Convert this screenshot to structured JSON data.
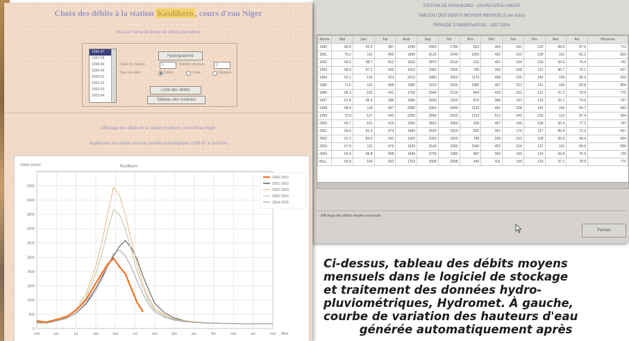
{
  "left_window": {
    "title_pre": "Choix des débits à la station",
    "title_station": "Koulikoro",
    "title_post": ", cours d'eau Niger",
    "subtitle": "Mise en forme du fichier de débits journaliers",
    "year_list": [
      "1996-97",
      "1997-98",
      "1998-99",
      "1999-00",
      "2000-01",
      "2001-02",
      "2002-03",
      "2003-04"
    ],
    "selected_year_index": 0,
    "button_hydrogramme": "Hydrogramme",
    "label_1": "Choix de l'année",
    "label_2": "Nombre de jours",
    "label_3": "Type de tracé",
    "radio_labels": [
      "Débits",
      "Cotes",
      "Volumes"
    ],
    "spin_1": "1",
    "spin_2": "1",
    "button_liste": "Liste des débits",
    "button_tableau": "Tableau des modules",
    "info_line_1": "Affichage des débits de la station Koulikoro, cours d'eau Niger",
    "info_line_2": "Superposer des débits annuels (années hydrologiques 1996-97 à 2003-04)"
  },
  "right_window": {
    "header_lines": [
      "STATION DE KOULIKORO - COURS D'EAU NIGER",
      "TABLEAU DES DEBITS MOYENS MENSUELS (en m3/s)",
      "PERIODE D'OBSERVATION : 1907-2004"
    ],
    "columns": [
      "Année",
      "Mai",
      "Juin",
      "Juil",
      "Août",
      "Sep",
      "Oct",
      "Nov",
      "Déc",
      "Jan",
      "Fév",
      "Mar",
      "Avr",
      "Moyenne"
    ],
    "rows": [
      [
        "1990",
        "86.8",
        "92.5",
        "387",
        "1540",
        "2560",
        "1780",
        "823",
        "364",
        "181",
        "120",
        "98.6",
        "87.6",
        "713"
      ],
      [
        "1991",
        "70.2",
        "110",
        "455",
        "1890",
        "3120",
        "2240",
        "1050",
        "452",
        "215",
        "138",
        "101",
        "81.2",
        "829"
      ],
      [
        "1992",
        "64.5",
        "98.7",
        "412",
        "1620",
        "2870",
        "2010",
        "912",
        "401",
        "194",
        "126",
        "94.3",
        "76.4",
        "741"
      ],
      [
        "1993",
        "58.9",
        "87.2",
        "356",
        "1410",
        "2350",
        "1690",
        "785",
        "342",
        "168",
        "112",
        "86.7",
        "70.1",
        "627"
      ],
      [
        "1994",
        "62.1",
        "124",
        "523",
        "2210",
        "3480",
        "2560",
        "1170",
        "498",
        "236",
        "149",
        "109",
        "85.3",
        "935"
      ],
      [
        "1995",
        "71.6",
        "115",
        "468",
        "1980",
        "3210",
        "2330",
        "1080",
        "467",
        "221",
        "141",
        "104",
        "82.8",
        "858"
      ],
      [
        "1996",
        "66.3",
        "103",
        "431",
        "1750",
        "2940",
        "2120",
        "964",
        "418",
        "201",
        "131",
        "97.2",
        "78.9",
        "775"
      ],
      [
        "1997",
        "61.8",
        "95.4",
        "398",
        "1580",
        "2690",
        "1920",
        "876",
        "386",
        "187",
        "123",
        "92.1",
        "74.6",
        "707"
      ],
      [
        "1998",
        "68.4",
        "118",
        "497",
        "2080",
        "3350",
        "2440",
        "1120",
        "481",
        "228",
        "145",
        "106",
        "83.7",
        "893"
      ],
      [
        "1999",
        "73.9",
        "127",
        "542",
        "2290",
        "3590",
        "2630",
        "1210",
        "512",
        "242",
        "153",
        "112",
        "87.4",
        "964"
      ],
      [
        "2000",
        "64.7",
        "101",
        "419",
        "1690",
        "2810",
        "2050",
        "928",
        "407",
        "196",
        "128",
        "95.6",
        "77.2",
        "747"
      ],
      [
        "2001",
        "59.6",
        "91.3",
        "374",
        "1490",
        "2520",
        "1810",
        "832",
        "361",
        "176",
        "117",
        "89.4",
        "72.3",
        "667"
      ],
      [
        "2002",
        "57.2",
        "84.6",
        "342",
        "1350",
        "2260",
        "1620",
        "748",
        "328",
        "162",
        "108",
        "83.5",
        "68.4",
        "604"
      ],
      [
        "2003",
        "67.5",
        "112",
        "476",
        "1930",
        "3140",
        "2280",
        "1040",
        "452",
        "214",
        "137",
        "101",
        "80.6",
        "838"
      ],
      [
        "2004",
        "63.4",
        "99.8",
        "408",
        "1640",
        "2730",
        "1980",
        "897",
        "394",
        "190",
        "124",
        "93.8",
        "75.9",
        "725"
      ],
      [
        "Moy.",
        "65.8",
        "104",
        "432",
        "1763",
        "2908",
        "2098",
        "949",
        "411",
        "199",
        "129",
        "97.1",
        "78.8",
        "775"
      ]
    ],
    "status_text": "Affichage des débits moyens mensuels",
    "close_button": "Fermer"
  },
  "caption_lines": [
    "Ci-dessus, tableau des débits moyens",
    "mensuels dans le logiciel de stockage",
    "et traitement des données hydro-",
    "pluviométriques, Hydromet. À gauche,",
    "courbe de variation des hauteurs d'eau",
    "         générée automatiquement après"
  ],
  "chart_data": {
    "type": "line",
    "title": "Koulikoro",
    "ylabel": "Débits (m3/s)",
    "xlabel": "Mois",
    "ylim": [
      0,
      6600
    ],
    "y_ticks": [
      0,
      600,
      1200,
      1800,
      2400,
      3000,
      3600,
      4200,
      4800,
      5400,
      6000
    ],
    "x_ticks": [
      "mai",
      "jun",
      "jul",
      "aoû",
      "sep",
      "oct",
      "nov",
      "déc",
      "jan",
      "fév",
      "mar",
      "avr",
      "mai"
    ],
    "x": [
      0,
      0.5,
      1,
      1.5,
      2,
      2.5,
      3,
      3.3,
      3.6,
      3.9,
      4.2,
      4.5,
      4.8,
      5.1,
      5.4,
      5.7,
      6,
      6.5,
      7,
      7.5,
      8,
      8.5,
      9,
      9.5,
      10,
      10.5,
      11,
      11.5,
      12
    ],
    "grid": true,
    "legend": "top-right",
    "series": [
      {
        "name": "2000-2001",
        "color": "#f07020",
        "width": 2.2,
        "values": [
          320,
          260,
          380,
          500,
          760,
          1200,
          1900,
          2300,
          2700,
          2950,
          2600,
          2300,
          1700,
          1100,
          700,
          null,
          null,
          null,
          null,
          null,
          null,
          null,
          null,
          null,
          null,
          null,
          null,
          null,
          null
        ]
      },
      {
        "name": "2001-2002",
        "color": "#3a3a3a",
        "width": 0.9,
        "values": [
          240,
          230,
          320,
          430,
          650,
          1050,
          1700,
          2150,
          2600,
          3050,
          3450,
          3700,
          3400,
          2900,
          2200,
          1600,
          1050,
          650,
          440,
          330,
          280,
          250,
          230,
          220,
          210,
          205,
          200,
          200,
          200
        ]
      },
      {
        "name": "2002-2003",
        "color": "#e8b77a",
        "width": 1.0,
        "values": [
          260,
          250,
          350,
          480,
          820,
          1450,
          2600,
          3600,
          4800,
          5950,
          5600,
          4800,
          3700,
          2700,
          1850,
          1250,
          850,
          560,
          400,
          320,
          280,
          250,
          230,
          220,
          210,
          205,
          200,
          200,
          200
        ]
      },
      {
        "name": "2003-2004",
        "color": "#b7c7a8",
        "width": 1.0,
        "values": [
          270,
          240,
          330,
          460,
          760,
          1300,
          2300,
          3100,
          4100,
          5000,
          4800,
          4200,
          3300,
          2400,
          1700,
          1150,
          780,
          520,
          380,
          300,
          260,
          240,
          225,
          215,
          205,
          200,
          200,
          200,
          200
        ]
      },
      {
        "name": "2004-2005",
        "color": "#9aa0b0",
        "width": 1.0,
        "values": [
          250,
          230,
          310,
          420,
          640,
          1020,
          1600,
          2050,
          2600,
          3150,
          3300,
          3050,
          2600,
          2000,
          1450,
          1000,
          700,
          470,
          350,
          290,
          250,
          230,
          220,
          210,
          205,
          200,
          200,
          200,
          200
        ]
      }
    ]
  }
}
